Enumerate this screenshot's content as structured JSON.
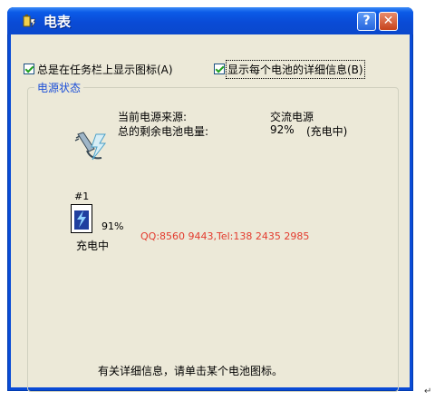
{
  "window": {
    "title": "电表",
    "help_glyph": "?",
    "close_glyph": "✕"
  },
  "options": {
    "always_show_icon": "总是在任务栏上显示图标(A)",
    "show_battery_details": "显示每个电池的详细信息(B)"
  },
  "power_status": {
    "group_title": "电源状态",
    "source_label": "当前电源来源:",
    "source_value": "交流电源",
    "remaining_label": "总的剩余电池电量:",
    "remaining_value": "92%",
    "remaining_state": "(充电中)"
  },
  "battery": {
    "number": "#1",
    "percent": "91%",
    "percent_value": 0.91,
    "state": "充电中"
  },
  "watermark": "QQ:8560 9443,Tel:138 2435 2985",
  "info_text": "有关详细信息，请单击某个电池图标。",
  "corner_mark": "↵",
  "colors": {
    "title_bar": "#0a4bd6",
    "client_bg": "#ece9d8",
    "group_title": "#1c4fd8",
    "watermark": "#e33b2e"
  }
}
